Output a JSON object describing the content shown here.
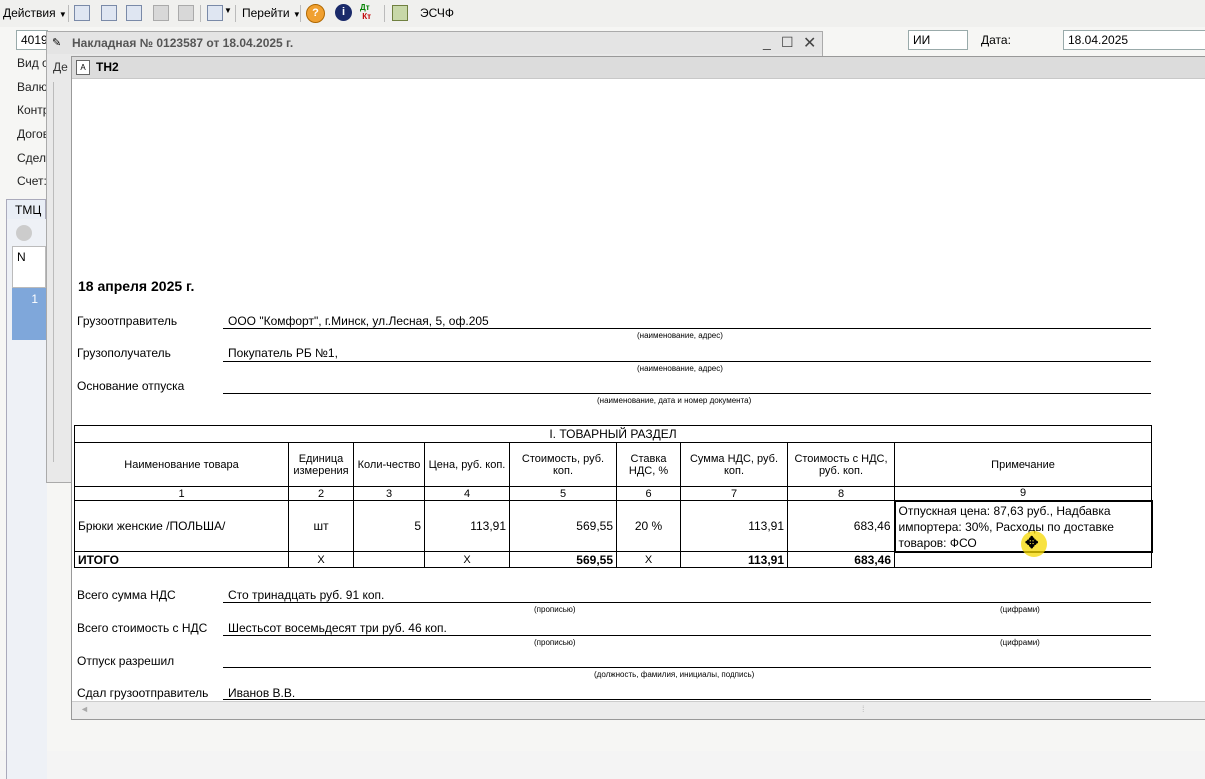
{
  "toolbar": {
    "actions_label": "Действия",
    "goto_label": "Перейти",
    "escf_label": "ЭСЧФ"
  },
  "background_form": {
    "number_value": "4019",
    "ii_value": "ИИ",
    "date_label": "Дата:",
    "date_value": "18.04.2025",
    "labels": [
      "Вид о",
      "Валю",
      "Контр",
      "Догов",
      "Сдел",
      "Счет:"
    ],
    "tab_label": "ТМЦ",
    "col_n": "N",
    "row_1": "1"
  },
  "invoice_window": {
    "title": "Накладная № 0123587 от 18.04.2025 г.",
    "frag_de": "Де"
  },
  "report_window": {
    "title": "ТН2"
  },
  "document": {
    "date_heading": "18 апреля 2025 г.",
    "shipper_label": "Грузоотправитель",
    "shipper_value": "ООО \"Комфорт\", г.Минск, ул.Лесная, 5, оф.205",
    "hint_name_address": "(наименование, адрес)",
    "consignee_label": "Грузополучатель",
    "consignee_value": "Покупатель РБ №1,",
    "basis_label": "Основание отпуска",
    "hint_basis": "(наименование, дата и номер документа)",
    "section_title": "I. ТОВАРНЫЙ РАЗДЕЛ",
    "columns": {
      "name": "Наименование товара",
      "unit": "Единица измерения",
      "qty": "Коли-чество",
      "price": "Цена, руб. коп.",
      "cost": "Стоимость, руб. коп.",
      "vat_rate": "Ставка НДС, %",
      "vat_sum": "Сумма НДС, руб. коп.",
      "cost_vat": "Стоимость с НДС, руб. коп.",
      "note": "Примечание"
    },
    "col_numbers": [
      "1",
      "2",
      "3",
      "4",
      "5",
      "6",
      "7",
      "8",
      "9"
    ],
    "item": {
      "name": "Брюки женские /ПОЛЬША/",
      "unit": "шт",
      "qty": "5",
      "price": "113,91",
      "cost": "569,55",
      "vat_rate": "20 %",
      "vat_sum": "113,91",
      "cost_vat": "683,46",
      "note": "Отпускная цена: 87,63 руб., Надбавка импортера: 30%, Расходы по доставке товаров: ФСО"
    },
    "total": {
      "label": "ИТОГО",
      "unit": "Х",
      "price": "Х",
      "cost": "569,55",
      "vat_rate": "Х",
      "vat_sum": "113,91",
      "cost_vat": "683,46"
    },
    "vat_total_label": "Всего сумма НДС",
    "vat_total_value": "Сто тринадцать руб. 91 коп.",
    "hint_words": "(прописью)",
    "hint_digits": "(цифрами)",
    "total_vat_label": "Всего стоимость с НДС",
    "total_vat_value": "Шестьсот восемьдесят три руб. 46 коп.",
    "release_label": "Отпуск разрешил",
    "hint_position": "(должность, фамилия, инициалы, подпись)",
    "handed_label": "Сдал грузоотправитель",
    "handed_value": "Иванов В.В."
  },
  "colors": {
    "selection_blue": "#7fa7da",
    "cursor_highlight": "#f5d800"
  }
}
